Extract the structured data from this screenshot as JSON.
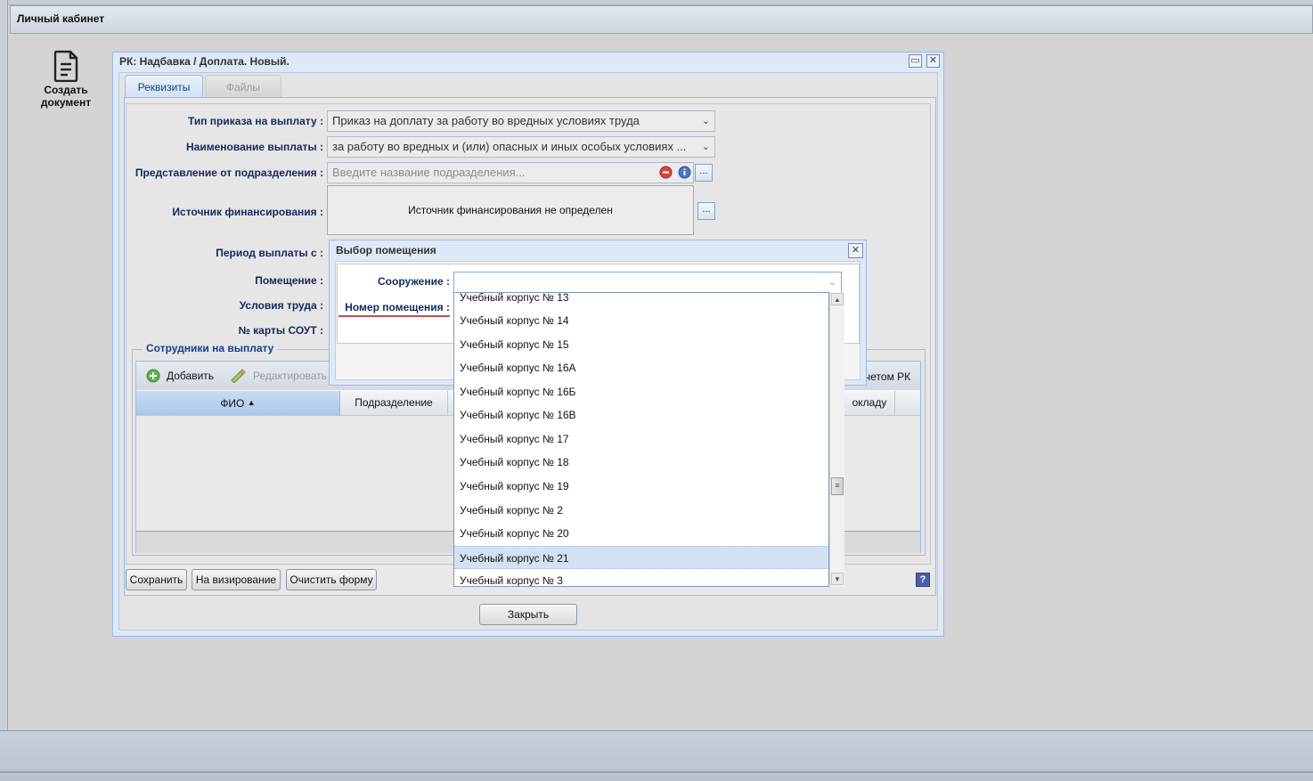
{
  "app": {
    "title": "Личный кабинет"
  },
  "desktop": {
    "create_doc_label_1": "Создать",
    "create_doc_label_2": "документ"
  },
  "window": {
    "title": "РК: Надбавка / Доплата. Новый.",
    "tabs": [
      {
        "label": "Реквизиты"
      },
      {
        "label": "Файлы"
      }
    ],
    "form": {
      "order_type_label": "Тип приказа на выплату :",
      "order_type_value": "Приказ на доплату за работу во вредных условиях труда",
      "payment_name_label": "Наименование выплаты :",
      "payment_name_value": "за работу во вредных и (или) опасных и иных особых условиях ...",
      "department_label": "Представление от подразделения :",
      "department_placeholder": "Введите название подразделения...",
      "funding_label": "Источник финансирования :",
      "funding_value": "Источник финансирования не определен",
      "period_label": "Период выплаты с :",
      "room_label": "Помещение :",
      "work_conditions_label": "Условия труда :",
      "sout_card_label": "№ карты СОУТ :"
    },
    "staff": {
      "legend": "Сотрудники на выплату",
      "add_label": "Добавить",
      "edit_label": "Редактировать",
      "toolbar_right_label": "четом РК",
      "columns": [
        {
          "label": "ФИО"
        },
        {
          "label": "Подразделение"
        },
        {
          "label": "окладу"
        }
      ]
    },
    "buttons": {
      "save": "Сохранить",
      "approve": "На визирование",
      "clear": "Очистить форму",
      "close": "Закрыть",
      "help": "?"
    }
  },
  "room_dialog": {
    "title": "Выбор помещения",
    "structure_label": "Сооружение :",
    "room_number_label": "Номер помещения :",
    "options": [
      "Учебный корпус № 13",
      "Учебный корпус № 14",
      "Учебный корпус № 15",
      "Учебный корпус № 16А",
      "Учебный корпус № 16Б",
      "Учебный корпус № 16В",
      "Учебный корпус № 17",
      "Учебный корпус № 18",
      "Учебный корпус № 19",
      "Учебный корпус № 2",
      "Учебный корпус № 20",
      "Учебный корпус № 21",
      "Учебный корпус № 3"
    ],
    "highlighted_option": "Учебный корпус № 21"
  }
}
